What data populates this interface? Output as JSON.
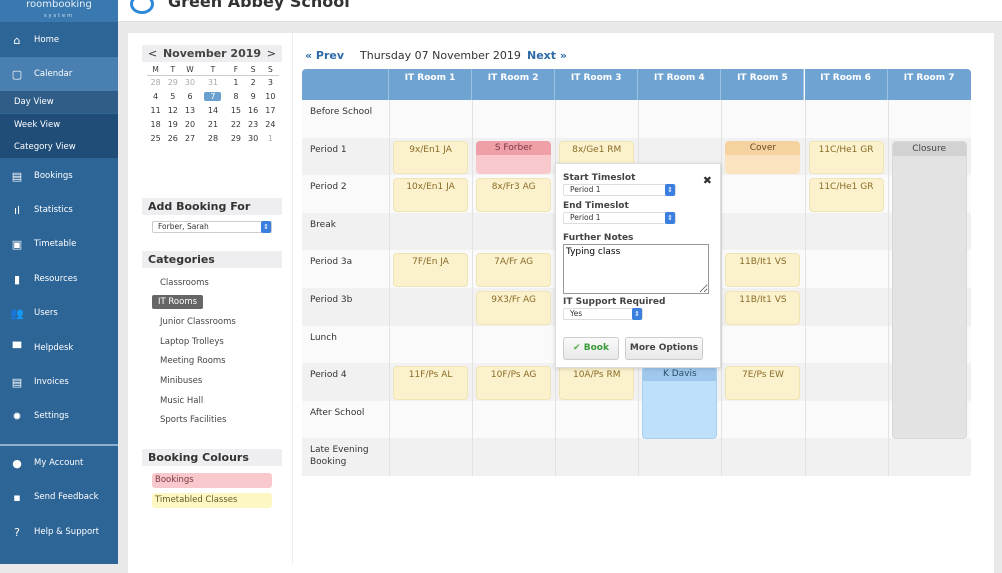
{
  "brand": {
    "name": "roombooking",
    "tag": "system"
  },
  "school": "Green Abbey School",
  "sidebar": {
    "items": [
      {
        "label": "Home",
        "icon": "home-icon",
        "glyph": "⌂"
      },
      {
        "label": "Calendar",
        "icon": "calendar-icon",
        "glyph": "▢"
      },
      {
        "label": "Bookings",
        "icon": "clipboard-icon",
        "glyph": "▤"
      },
      {
        "label": "Statistics",
        "icon": "bar-chart-icon",
        "glyph": "ıl"
      },
      {
        "label": "Timetable",
        "icon": "timetable-icon",
        "glyph": "▣"
      },
      {
        "label": "Resources",
        "icon": "door-icon",
        "glyph": "▮"
      },
      {
        "label": "Users",
        "icon": "users-icon",
        "glyph": "👥"
      },
      {
        "label": "Helpdesk",
        "icon": "chat-icon",
        "glyph": "▀"
      },
      {
        "label": "Invoices",
        "icon": "document-icon",
        "glyph": "▤"
      },
      {
        "label": "Settings",
        "icon": "gear-icon",
        "glyph": "✹"
      },
      {
        "label": "My Account",
        "icon": "account-icon",
        "glyph": "●"
      },
      {
        "label": "Send Feedback",
        "icon": "feedback-icon",
        "glyph": "▪"
      },
      {
        "label": "Help & Support",
        "icon": "help-icon",
        "glyph": "?"
      }
    ],
    "sub": [
      "Day View",
      "Week View",
      "Category View"
    ]
  },
  "calendar": {
    "month": "November 2019",
    "prev": "<",
    "next": ">",
    "days": [
      "M",
      "T",
      "W",
      "T",
      "F",
      "S",
      "S"
    ],
    "weeks": [
      [
        "28",
        "29",
        "30",
        "31",
        "1",
        "2",
        "3"
      ],
      [
        "4",
        "5",
        "6",
        "7",
        "8",
        "9",
        "10"
      ],
      [
        "11",
        "12",
        "13",
        "14",
        "15",
        "16",
        "17"
      ],
      [
        "18",
        "19",
        "20",
        "21",
        "22",
        "23",
        "24"
      ],
      [
        "25",
        "26",
        "27",
        "28",
        "29",
        "30",
        "1"
      ]
    ],
    "today": "7"
  },
  "add_booking": {
    "title": "Add Booking For",
    "value": "Forber, Sarah"
  },
  "categories": {
    "title": "Categories",
    "items": [
      "Classrooms",
      "IT Rooms",
      "Junior Classrooms",
      "Laptop Trolleys",
      "Meeting Rooms",
      "Minibuses",
      "Music Hall",
      "Sports Facilities"
    ],
    "selected": "IT Rooms"
  },
  "colours": {
    "title": "Booking Colours",
    "items": [
      {
        "label": "Bookings",
        "color": "#f8c8cc"
      },
      {
        "label": "Timetabled Classes",
        "color": "#fdf7c4"
      }
    ]
  },
  "daynav": {
    "prev": "« Prev",
    "date": "Thursday 07 November 2019",
    "next": "Next »"
  },
  "grid": {
    "rooms": [
      "IT Room 1",
      "IT Room 2",
      "IT Room 3",
      "IT Room 4",
      "IT Room 5",
      "IT Room 6",
      "IT Room 7"
    ],
    "periods": [
      "Before School",
      "Period 1",
      "Period 2",
      "Break",
      "Period 3a",
      "Period 3b",
      "Lunch",
      "Period 4",
      "After School",
      "Late Evening Booking"
    ],
    "bookings": [
      {
        "room": 0,
        "period": 1,
        "span": 1,
        "type": "tt",
        "label": "9x/En1 JA"
      },
      {
        "room": 1,
        "period": 1,
        "span": 1,
        "type": "pink",
        "label": "S Forber"
      },
      {
        "room": 2,
        "period": 1,
        "span": 1,
        "type": "tt",
        "label": "8x/Ge1 RM"
      },
      {
        "room": 4,
        "period": 1,
        "span": 1,
        "type": "cover",
        "label": "Cover"
      },
      {
        "room": 5,
        "period": 1,
        "span": 1,
        "type": "tt",
        "label": "11C/He1 GR"
      },
      {
        "room": 6,
        "period": 1,
        "span": 8,
        "type": "gray",
        "label": "Closure"
      },
      {
        "room": 0,
        "period": 2,
        "span": 1,
        "type": "tt",
        "label": "10x/En1 JA"
      },
      {
        "room": 1,
        "period": 2,
        "span": 1,
        "type": "tt",
        "label": "8x/Fr3 AG"
      },
      {
        "room": 5,
        "period": 2,
        "span": 1,
        "type": "tt",
        "label": "11C/He1 GR"
      },
      {
        "room": 0,
        "period": 4,
        "span": 1,
        "type": "tt",
        "label": "7F/En JA"
      },
      {
        "room": 1,
        "period": 4,
        "span": 1,
        "type": "tt",
        "label": "7A/Fr AG"
      },
      {
        "room": 4,
        "period": 4,
        "span": 1,
        "type": "tt",
        "label": "11B/It1 VS"
      },
      {
        "room": 1,
        "period": 5,
        "span": 1,
        "type": "tt",
        "label": "9X3/Fr AG"
      },
      {
        "room": 4,
        "period": 5,
        "span": 1,
        "type": "tt",
        "label": "11B/It1 VS"
      },
      {
        "room": 0,
        "period": 7,
        "span": 1,
        "type": "tt",
        "label": "11F/Ps AL"
      },
      {
        "room": 1,
        "period": 7,
        "span": 1,
        "type": "tt",
        "label": "10F/Ps AG"
      },
      {
        "room": 2,
        "period": 7,
        "span": 1,
        "type": "tt",
        "label": "10A/Ps RM"
      },
      {
        "room": 3,
        "period": 7,
        "span": 2,
        "type": "blue",
        "label": "K Davis"
      },
      {
        "room": 4,
        "period": 7,
        "span": 1,
        "type": "tt",
        "label": "7E/Ps EW"
      }
    ]
  },
  "popup": {
    "start_label": "Start Timeslot",
    "start_value": "Period 1",
    "end_label": "End Timeslot",
    "end_value": "Period 1",
    "notes_label": "Further Notes",
    "notes_value": "Typing class",
    "it_label": "IT Support Required",
    "it_value": "Yes",
    "book": "Book",
    "more": "More Options",
    "close": "✖"
  }
}
